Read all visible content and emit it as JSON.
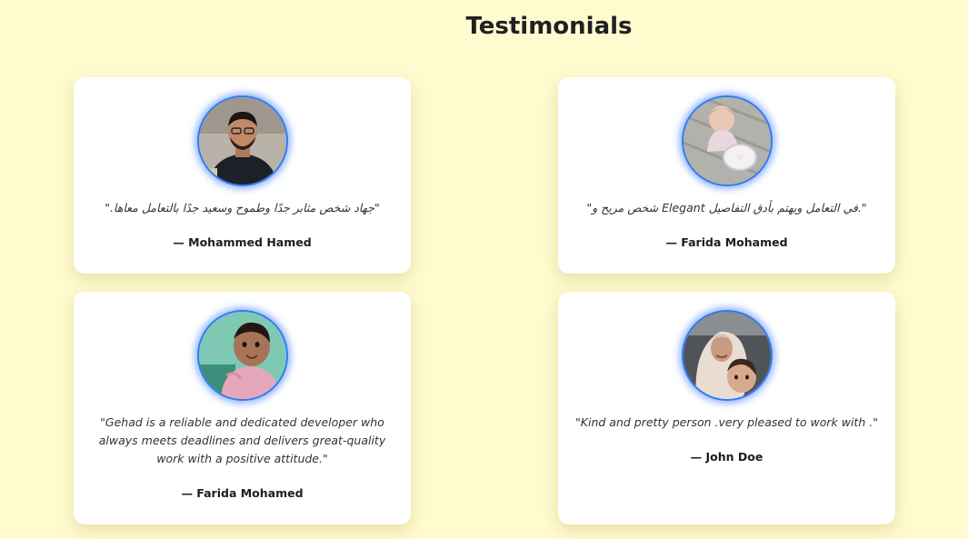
{
  "page": {
    "title": "Testimonials",
    "background": "#fffbcf",
    "accent": "#2f7cf6"
  },
  "testimonials": [
    {
      "quote": "\"جهاد شخص مثابر جدًا وطموح وسعيد جدًا بالتعامل معاها.\"",
      "author": "— Mohammed Hamed",
      "avatar": "man-with-glasses-photo",
      "rtl": true
    },
    {
      "quote": "\".في التعامل ويهتم بأدق التفاصيل Elegant شخص مريح و\"",
      "author": "— Farida Mohamed",
      "avatar": "baby-with-balloon-photo",
      "rtl": true
    },
    {
      "quote": "\"Gehad is a reliable and dedicated developer who always meets deadlines and delivers great-quality work with a positive attitude.\"",
      "author": "— Farida Mohamed",
      "avatar": "toddler-pink-outfit-photo",
      "rtl": false
    },
    {
      "quote": "\"Kind and pretty person .very pleased to work with .\"",
      "author": "— John Doe",
      "avatar": "woman-and-child-selfie-photo",
      "rtl": false
    }
  ]
}
